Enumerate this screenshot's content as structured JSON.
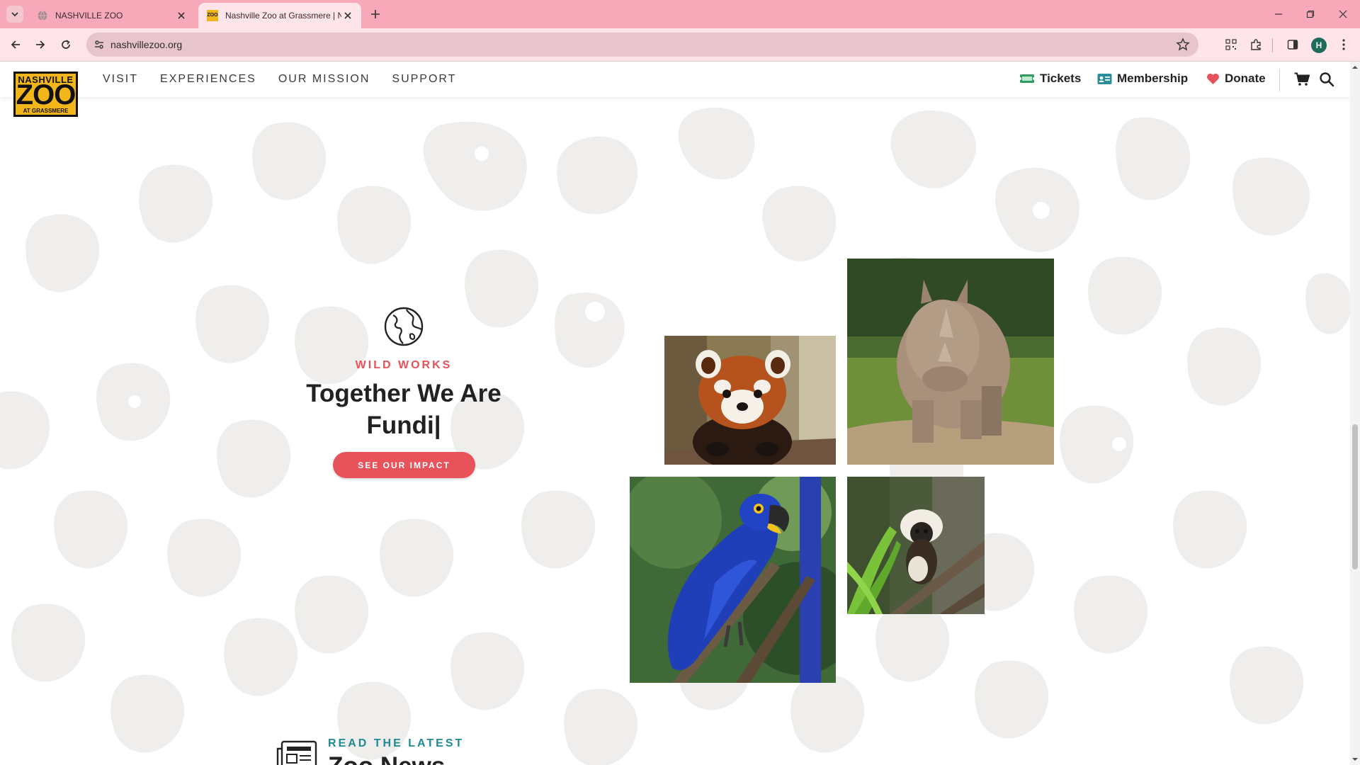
{
  "browser": {
    "tabs": [
      {
        "title": "NASHVILLE ZOO",
        "active": false
      },
      {
        "title": "Nashville Zoo at Grassmere | Na",
        "active": true
      }
    ],
    "active_favicon_text": "ZOO",
    "url": "nashvillezoo.org",
    "profile_initial": "H"
  },
  "header": {
    "logo": {
      "line1": "NASHVILLE",
      "line2": "ZOO",
      "line3": "AT GRASSMERE"
    },
    "nav": [
      "VISIT",
      "EXPERIENCES",
      "OUR MISSION",
      "SUPPORT"
    ],
    "utility": {
      "tickets": "Tickets",
      "membership": "Membership",
      "donate": "Donate"
    },
    "icons": [
      "ticket-icon",
      "membership-card-icon",
      "heart-icon",
      "cart-icon",
      "search-icon"
    ]
  },
  "wild_works": {
    "icon": "globe-icon",
    "eyebrow": "WILD WORKS",
    "headline_line1": "Together We Are",
    "headline_line2": "Fundi|",
    "cta": "SEE OUR IMPACT"
  },
  "photos": [
    "red-panda-photo",
    "rhino-photo",
    "hyacinth-macaw-photo",
    "tamarin-photo"
  ],
  "news": {
    "icon": "newspaper-icon",
    "eyebrow": "READ THE LATEST",
    "title": "Zoo News"
  },
  "colors": {
    "tabbar": "#f7a9ba",
    "toolbar": "#ffe4ea",
    "accent_red": "#e8525a",
    "accent_teal": "#1f8a8f",
    "logo_yellow": "#f2b51a",
    "pattern": "#efeeec"
  }
}
